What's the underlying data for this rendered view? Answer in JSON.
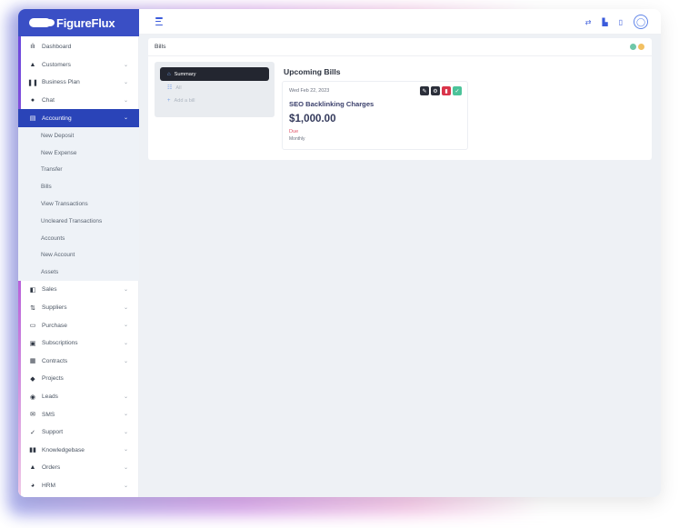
{
  "app": {
    "brand": "FigureFlux"
  },
  "colors": {
    "accent": "#2a44b8",
    "brand_bar": "#3a4fc5",
    "due": "#e0566a"
  },
  "sidebar": {
    "items": [
      {
        "label": "Dashboard",
        "icon": "bar-chart-icon",
        "glyph": "ılı",
        "chevron": false
      },
      {
        "label": "Customers",
        "icon": "user-icon",
        "glyph": "▲",
        "chevron": true
      },
      {
        "label": "Business Plan",
        "icon": "columns-icon",
        "glyph": "❚❚",
        "chevron": true
      },
      {
        "label": "Chat",
        "icon": "chat-icon",
        "glyph": "●",
        "chevron": true
      },
      {
        "label": "Accounting",
        "icon": "calculator-icon",
        "glyph": "▤",
        "chevron": true,
        "active": true
      }
    ],
    "subitems": [
      "New Deposit",
      "New Expense",
      "Transfer",
      "Bills",
      "View Transactions",
      "Uncleared Transactions",
      "Accounts",
      "New Account",
      "Assets"
    ],
    "items_after": [
      {
        "label": "Sales",
        "icon": "wallet-icon",
        "glyph": "◧",
        "chevron": true
      },
      {
        "label": "Suppliers",
        "icon": "suppliers-icon",
        "glyph": "⇅",
        "chevron": true
      },
      {
        "label": "Purchase",
        "icon": "card-icon",
        "glyph": "▭",
        "chevron": true
      },
      {
        "label": "Subscriptions",
        "icon": "ticket-icon",
        "glyph": "▣",
        "chevron": true
      },
      {
        "label": "Contracts",
        "icon": "contract-icon",
        "glyph": "▦",
        "chevron": true
      },
      {
        "label": "Projects",
        "icon": "rocket-icon",
        "glyph": "◆",
        "chevron": false
      },
      {
        "label": "Leads",
        "icon": "lead-icon",
        "glyph": "◉",
        "chevron": true
      },
      {
        "label": "SMS",
        "icon": "message-icon",
        "glyph": "✉",
        "chevron": true
      },
      {
        "label": "Support",
        "icon": "support-icon",
        "glyph": "✓",
        "chevron": true
      },
      {
        "label": "Knowledgebase",
        "icon": "book-icon",
        "glyph": "▮▮",
        "chevron": true
      },
      {
        "label": "Orders",
        "icon": "bag-icon",
        "glyph": "▲",
        "chevron": true
      },
      {
        "label": "HRM",
        "icon": "team-icon",
        "glyph": "◕",
        "chevron": true
      }
    ]
  },
  "header": {
    "icons": [
      "transfer-icon",
      "file-icon",
      "clipboard-icon",
      "user-avatar-icon"
    ]
  },
  "main": {
    "card_title": "Bills",
    "panel": [
      {
        "label": "Summary",
        "icon": "home-icon",
        "active": true
      },
      {
        "label": "All",
        "icon": "people-icon",
        "active": false
      },
      {
        "label": "Add a bill",
        "icon": "plus-icon",
        "active": false
      }
    ],
    "upcoming_title": "Upcoming Bills",
    "bill": {
      "date": "Wed Feb 22, 2023",
      "name": "SEO Backlinking Charges",
      "amount": "$1,000.00",
      "status": "Due",
      "frequency": "Monthly",
      "actions": [
        {
          "icon": "edit-icon",
          "glyph": "✎",
          "color": "#2b2f3a"
        },
        {
          "icon": "settings-icon",
          "glyph": "⚙",
          "color": "#2b2f3a"
        },
        {
          "icon": "delete-icon",
          "glyph": "▮",
          "color": "#d9344a"
        },
        {
          "icon": "check-icon",
          "glyph": "✓",
          "color": "#4cc39a"
        }
      ]
    }
  }
}
